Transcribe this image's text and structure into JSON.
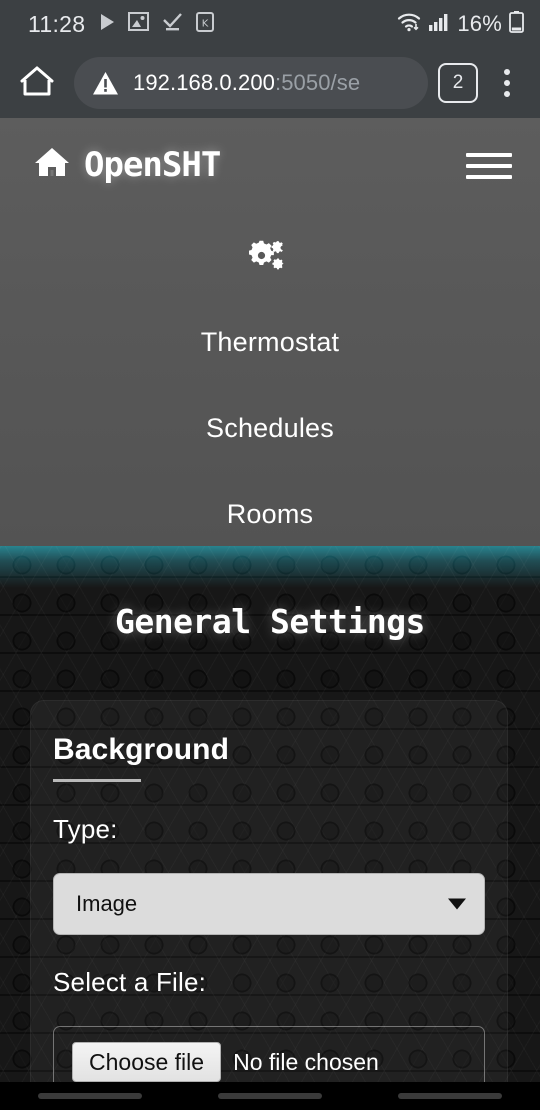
{
  "status_bar": {
    "clock": "11:28",
    "battery_percent": "16%",
    "left_icons": [
      "play-icon",
      "image-icon",
      "download-complete-icon",
      "sim-k-icon"
    ],
    "right_icons": [
      "wifi-download-icon",
      "cellular-signal-icon",
      "battery-icon"
    ]
  },
  "browser": {
    "home_icon": "home-icon",
    "security_icon": "warning-triangle-icon",
    "url_host": "192.168.0.200",
    "url_path": ":5050/se",
    "tab_count": "2",
    "menu_icon": "kebab-menu-icon"
  },
  "app_header": {
    "logo_icon": "house-icon",
    "brand": "OpenSHT",
    "menu_icon": "hamburger-menu-icon",
    "section_icon": "gears-icon",
    "nav_items": [
      {
        "label": "Thermostat"
      },
      {
        "label": "Schedules"
      },
      {
        "label": "Rooms"
      }
    ]
  },
  "page": {
    "title": "General Settings",
    "accent_color": "#178c9b",
    "background_color": "#171717"
  },
  "settings_panel": {
    "section_heading": "Background",
    "type_label": "Type:",
    "type_value": "Image",
    "type_options": [
      "Image"
    ],
    "file_label": "Select a File:",
    "choose_file_button": "Choose file",
    "file_status": "No file chosen"
  },
  "system_nav": {
    "pills": [
      "recents-pill",
      "home-pill",
      "back-pill"
    ]
  }
}
